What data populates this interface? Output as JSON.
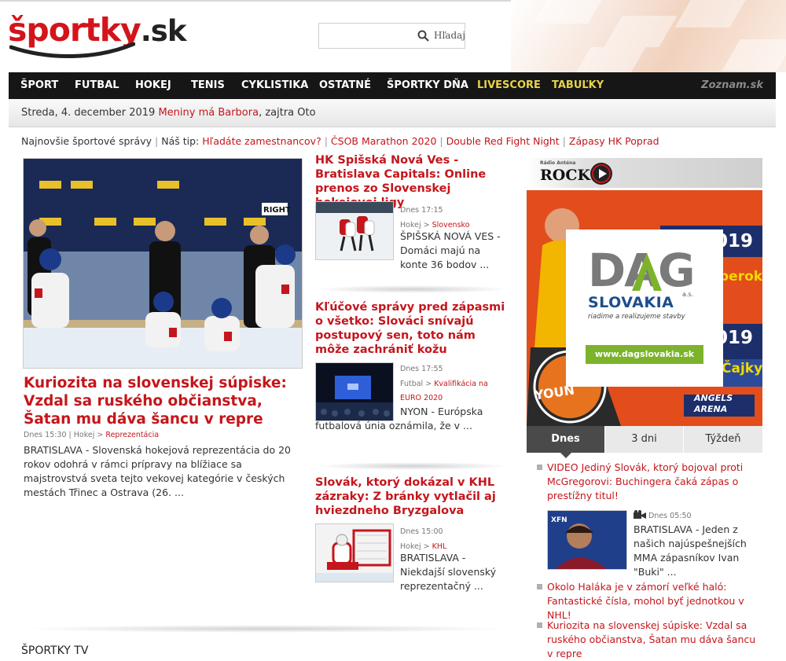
{
  "logo": {
    "part1": "športky",
    "part2": ".sk"
  },
  "search": {
    "value": "",
    "placeholder": "",
    "button_label": "Hľadaj"
  },
  "nav": {
    "items": [
      "ŠPORT",
      "FUTBAL",
      "HOKEJ",
      "TENIS",
      "CYKLISTIKA",
      "OSTATNÉ",
      "ŠPORTKY DŇA",
      "LIVESCORE",
      "TABUĽKY"
    ],
    "partner": "Zoznam.sk"
  },
  "datebar": {
    "date": "Streda, 4. december 2019",
    "nameday": "Meniny má Barbora",
    "tomorrow": ", zajtra Oto"
  },
  "newsline": {
    "label": "Najnovšie športové správy",
    "tip_label": "Náš tip:",
    "links": [
      "Hľadáte zamestnancov?",
      "ČSOB Marathon 2020",
      "Double Red Fight Night",
      "Zápasy HK Poprad"
    ]
  },
  "main_article": {
    "image_sign": "RIGHT",
    "title": "Kuriozita na slovenskej súpiske: Vzdal sa ruského občianstva, Šatan mu dáva šancu v repre",
    "time": "Dnes 15:30",
    "category": "Hokej",
    "subcategory": "Reprezentácia",
    "perex": "BRATISLAVA - Slovenská hokejová reprezentácia do 20 rokov odohrá v rámci prípravy na blížiace sa majstrovstvá sveta tejto vekovej kategórie v českých mestách Třinec a Ostrava (26. ..."
  },
  "middle_articles": [
    {
      "title": "HK Spišská Nová Ves - Bratislava Capitals: Online prenos zo Slovenskej hokejovej ligy",
      "time": "Dnes 17:15",
      "category": "Hokej",
      "subcategory": "Slovensko",
      "perex": "ŠPIŠSKÁ NOVÁ VES - Domáci majú na konte 36 bodov ..."
    },
    {
      "title": "Kľúčové správy pred zápasmi o všetko: Slováci snívajú postupový sen, toto nám môže zachrániť kožu",
      "time": "Dnes 17:55",
      "category": "Futbal",
      "subcategory": "Kvalifikácia na EURO 2020",
      "perex": "NYON - Európska futbalová únia oznámila, že v ..."
    },
    {
      "title": "Slovák, ktorý dokázal v KHL zázraky: Z bránky vytlačil aj hviezdneho Bryzgalova",
      "time": "Dnes 15:00",
      "category": "Hokej",
      "subcategory": "KHL",
      "perex": "BRATISLAVA - Niekdajší slovenský reprezentačný ..."
    }
  ],
  "radio": {
    "brand_small": "Rádio Anténa",
    "brand": "ROCK"
  },
  "ad": {
    "logo": "DAG",
    "name": "SLOVAKIA",
    "suffix": "a.s.",
    "slogan": "riadime a realizujeme stavby",
    "url": "www.dagslovakia.sk",
    "bg_year_1": "019",
    "bg_word_1": "berok",
    "bg_year_2": "019",
    "bg_word_2": "Čajky",
    "bg_young": "YOUN",
    "arena_1": "ANGELS",
    "arena_2": "ARENA"
  },
  "tabs": [
    "Dnes",
    "3 dni",
    "Týždeň"
  ],
  "right_list": [
    {
      "text": "VIDEO Jediný Slovák, ktorý bojoval proti McGregorovi: Buchingera čaká zápas o prestížny titul!"
    },
    {
      "text": "Okolo Haláka je v zámorí veľké haló: Fantastické čísla, mohol byť jednotkou v NHL!"
    },
    {
      "text": "Kuriozita na slovenskej súpiske: Vzdal sa ruského občianstva, Šatan mu dáva šancu v repre"
    }
  ],
  "right_feature": {
    "time": "Dnes 05:50",
    "perex": "BRATISLAVA - Jeden z našich najúspešnejších MMA zápasníkov Ivan \"Buki\" ...",
    "thumb_logo": "XFN"
  },
  "section_tv": "ŠPORTKY TV",
  "colors": {
    "brand_red": "#c4161c",
    "nav_bg": "#161616",
    "nav_highlight": "#e8d34a",
    "ad_orange": "#e24d1b",
    "tab_active": "#4a4a4a"
  }
}
